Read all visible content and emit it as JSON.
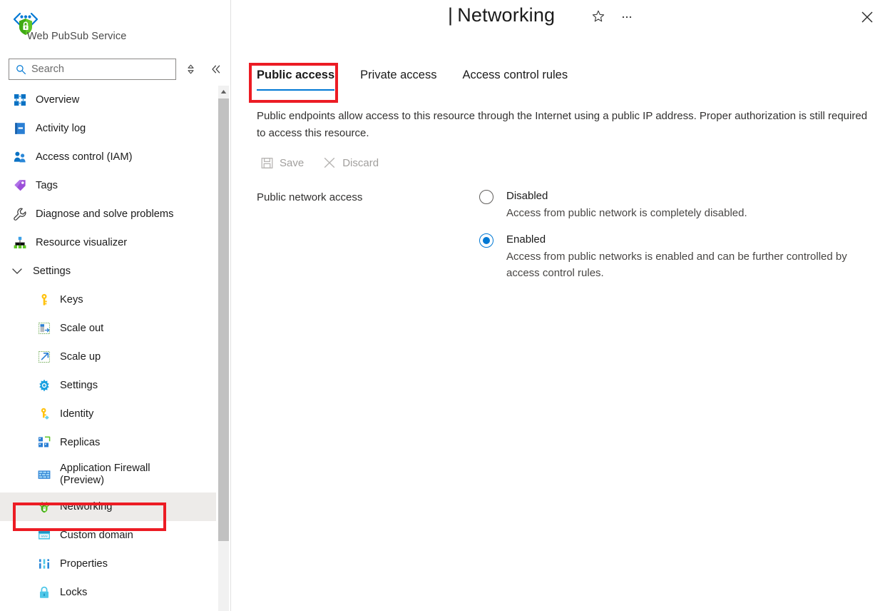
{
  "brand": {
    "logo_icon": "web-pubsub-logo",
    "name": "Web PubSub Service"
  },
  "search": {
    "placeholder": "Search",
    "value": "",
    "icon": "search-icon",
    "sort_icon": "up-down-chevron-icon",
    "collapse_icon": "double-chevron-left-icon"
  },
  "header": {
    "separator": "|",
    "title": "Networking",
    "favorite_icon": "star-outline-icon",
    "more_icon": "ellipsis-icon",
    "close_icon": "close-x-icon"
  },
  "sidebar": {
    "items": [
      {
        "label": "Overview",
        "icon": "overview-grid-icon",
        "level": 0,
        "selected": false
      },
      {
        "label": "Activity log",
        "icon": "activity-log-icon",
        "level": 0,
        "selected": false
      },
      {
        "label": "Access control (IAM)",
        "icon": "access-control-people-icon",
        "level": 0,
        "selected": false
      },
      {
        "label": "Tags",
        "icon": "tags-icon",
        "level": 0,
        "selected": false
      },
      {
        "label": "Diagnose and solve problems",
        "icon": "wrench-icon",
        "level": 0,
        "selected": false
      },
      {
        "label": "Resource visualizer",
        "icon": "resource-visualizer-icon",
        "level": 0,
        "selected": false
      },
      {
        "label": "Settings",
        "icon": "chevron-down-icon",
        "level": 0,
        "selected": false,
        "group": true
      },
      {
        "label": "Keys",
        "icon": "key-icon",
        "level": 1,
        "selected": false
      },
      {
        "label": "Scale out",
        "icon": "scale-out-icon",
        "level": 1,
        "selected": false
      },
      {
        "label": "Scale up",
        "icon": "scale-up-icon",
        "level": 1,
        "selected": false
      },
      {
        "label": "Settings",
        "icon": "gear-icon",
        "level": 1,
        "selected": false
      },
      {
        "label": "Identity",
        "icon": "identity-key-icon",
        "level": 1,
        "selected": false
      },
      {
        "label": "Replicas",
        "icon": "replicas-icon",
        "level": 1,
        "selected": false
      },
      {
        "label": "Application Firewall (Preview)",
        "icon": "firewall-icon",
        "level": 1,
        "selected": false,
        "twoline": true
      },
      {
        "label": "Networking",
        "icon": "networking-icon",
        "level": 1,
        "selected": true,
        "highlighted": true
      },
      {
        "label": "Custom domain",
        "icon": "custom-domain-icon",
        "level": 1,
        "selected": false
      },
      {
        "label": "Properties",
        "icon": "properties-icon",
        "level": 1,
        "selected": false
      },
      {
        "label": "Locks",
        "icon": "lock-icon",
        "level": 1,
        "selected": false
      }
    ]
  },
  "main": {
    "tabs": [
      {
        "label": "Public access",
        "active": true,
        "highlighted": true
      },
      {
        "label": "Private access",
        "active": false,
        "highlighted": false
      },
      {
        "label": "Access control rules",
        "active": false,
        "highlighted": false
      }
    ],
    "description": "Public endpoints allow access to this resource through the Internet using a public IP address. Proper authorization is still required to access this resource.",
    "commands": [
      {
        "label": "Save",
        "icon": "save-disk-icon",
        "disabled": true
      },
      {
        "label": "Discard",
        "icon": "discard-x-icon",
        "disabled": true
      }
    ],
    "field": {
      "label": "Public network access",
      "options": [
        {
          "title": "Disabled",
          "description": "Access from public network is completely disabled.",
          "checked": false
        },
        {
          "title": "Enabled",
          "description": "Access from public networks is enabled and can be further controlled by access control rules.",
          "checked": true
        }
      ]
    }
  },
  "colors": {
    "accent": "#0078d4",
    "highlight_box": "#ec1c24",
    "selected_row": "#edebe9",
    "text": "#1b1b1b",
    "muted_text": "#a19f9d"
  }
}
